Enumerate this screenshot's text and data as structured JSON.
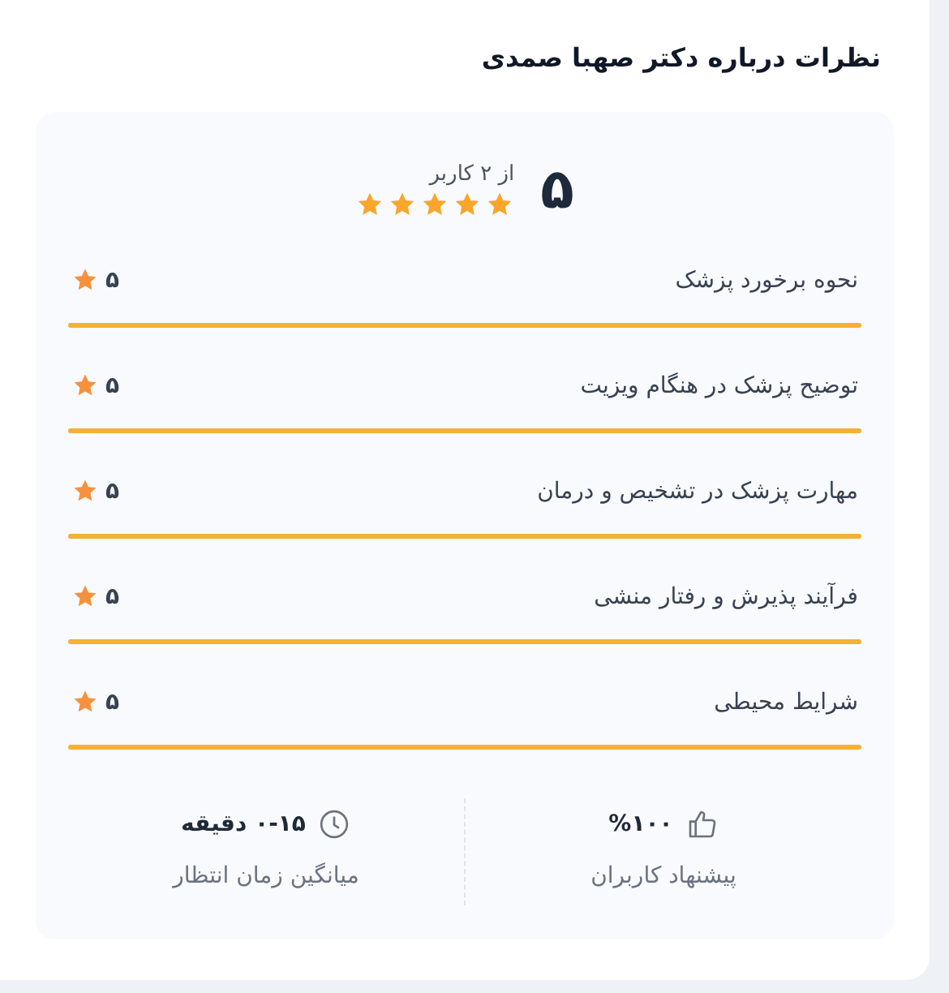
{
  "title": "نظرات درباره دکتر صهبا صمدی",
  "summary": {
    "score": "۵",
    "count_text": "از ۲ کاربر",
    "stars": 5
  },
  "criteria": [
    {
      "label": "نحوه برخورد پزشک",
      "score": "۵",
      "level": 1
    },
    {
      "label": "توضیح پزشک در هنگام ویزیت",
      "score": "۵",
      "level": 1
    },
    {
      "label": "مهارت پزشک در تشخیص و درمان",
      "score": "۵",
      "level": 1
    },
    {
      "label": "فرآیند پذیرش و رفتار منشی",
      "score": "۵",
      "level": 1
    },
    {
      "label": "شرایط محیطی",
      "score": "۵",
      "level": 1
    }
  ],
  "stats": [
    {
      "kind": "recommend",
      "value": "%۱۰۰",
      "caption": "پیشنهاد کاربران"
    },
    {
      "kind": "wait",
      "value": "۰-۱۵ دقیقه",
      "caption": "میانگین زمان انتظار"
    }
  ]
}
